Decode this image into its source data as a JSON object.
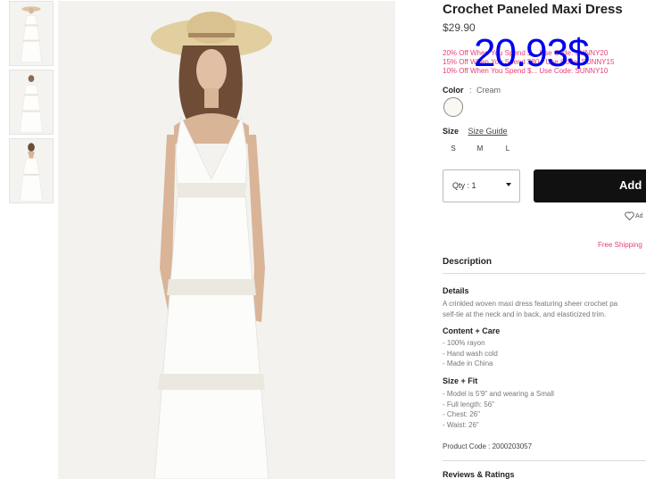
{
  "thumbnails": [
    {
      "name": "front view"
    },
    {
      "name": "front view close"
    },
    {
      "name": "back view"
    }
  ],
  "product": {
    "title": "Crochet Paneled Maxi Dress",
    "price": "$29.90",
    "overlay_price": "20.93$",
    "promos": [
      "20% Off When You Spend $... Use Code: SUNNY20",
      "15% Off When You Spend $80 - Use Code: SUNNY15",
      "10% Off When You Spend $... Use Code: SUNNY10"
    ],
    "color_label": "Color",
    "color_separator": ":",
    "color_value": "Cream",
    "swatch_color": "#faf8f2",
    "size_label": "Size",
    "size_guide": "Size Guide",
    "sizes": [
      "S",
      "M",
      "L"
    ],
    "qty_label": "Qty : 1",
    "add_button": "Add",
    "wishlist": "Ad",
    "free_shipping": "Free Shipping"
  },
  "description": {
    "heading": "Description",
    "details_heading": "Details",
    "details_lines": [
      "A crinkled woven maxi dress featuring sheer crochet pa",
      "self-tie at the neck and in back, and elasticized trim."
    ],
    "content_heading": "Content + Care",
    "content_lines": [
      "- 100% rayon",
      "- Hand wash cold",
      "- Made in China"
    ],
    "fit_heading": "Size + Fit",
    "fit_lines": [
      "- Model is 5'9\" and wearing a Small",
      "- Full length: 56\"",
      "- Chest: 26\"",
      "- Waist: 26\""
    ],
    "product_code": "Product Code : 2000203057",
    "reviews_heading": "Reviews & Ratings"
  },
  "colors": {
    "accent_pink": "#e6407a",
    "overlay_blue": "#0000ee",
    "button_black": "#111111"
  }
}
